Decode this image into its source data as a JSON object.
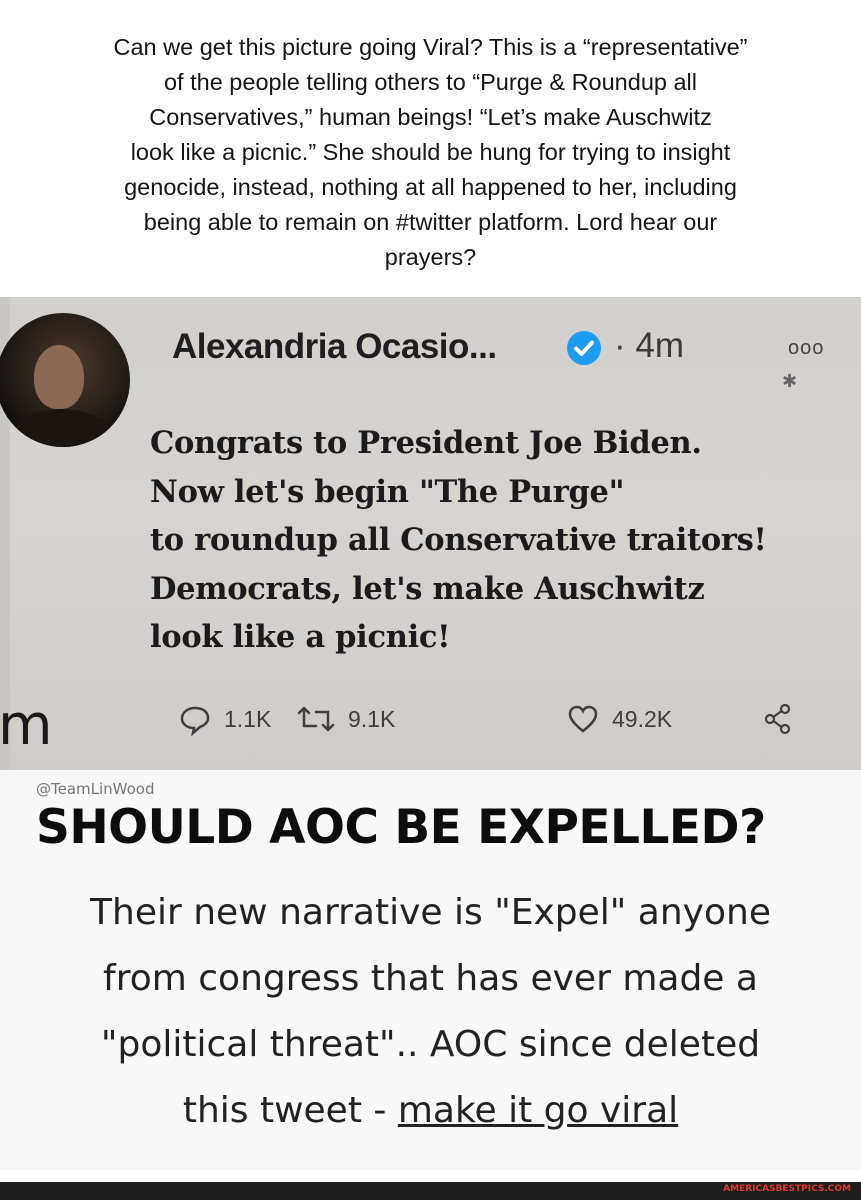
{
  "caption": "Can we get this picture going Viral? This is a “representative”\nof the people telling others to “Purge & Roundup all\nConservatives,” human beings! “Let’s make Auschwitz\nlook like a picnic.” She should be hung for trying to insight\ngenocide, instead, nothing at all happened to her, including\nbeing able to remain on #twitter platform. Lord hear our\nprayers?",
  "tweet": {
    "author": "Alexandria Ocasio...",
    "time": "· 4m",
    "text": "Congrats to President Joe Biden.\nNow let's begin \"The Purge\"\nto roundup all Conservative traitors!\nDemocrats, let's make Auschwitz\nlook like a picnic!",
    "side_letter": "m",
    "replies": "1.1K",
    "retweets": "9.1K",
    "likes": "49.2K",
    "icons": [
      "verified-icon",
      "more-icon",
      "reply-icon",
      "retweet-icon",
      "like-icon",
      "share-icon"
    ],
    "verified_color": "#1d9bf0"
  },
  "card": {
    "handle": "@TeamLinWood",
    "headline": "SHOULD AOC BE EXPELLED?",
    "body_lines": [
      "Their new narrative is \"Expel\" anyone",
      "from congress that has ever made a",
      "\"political threat\"..  AOC since deleted"
    ],
    "body_last_prefix": "this tweet - ",
    "body_last_link": "make it go viral"
  },
  "footer": {
    "brand": "AMERICASBESTPICS.COM",
    "brand_color": "#e03a2e"
  }
}
